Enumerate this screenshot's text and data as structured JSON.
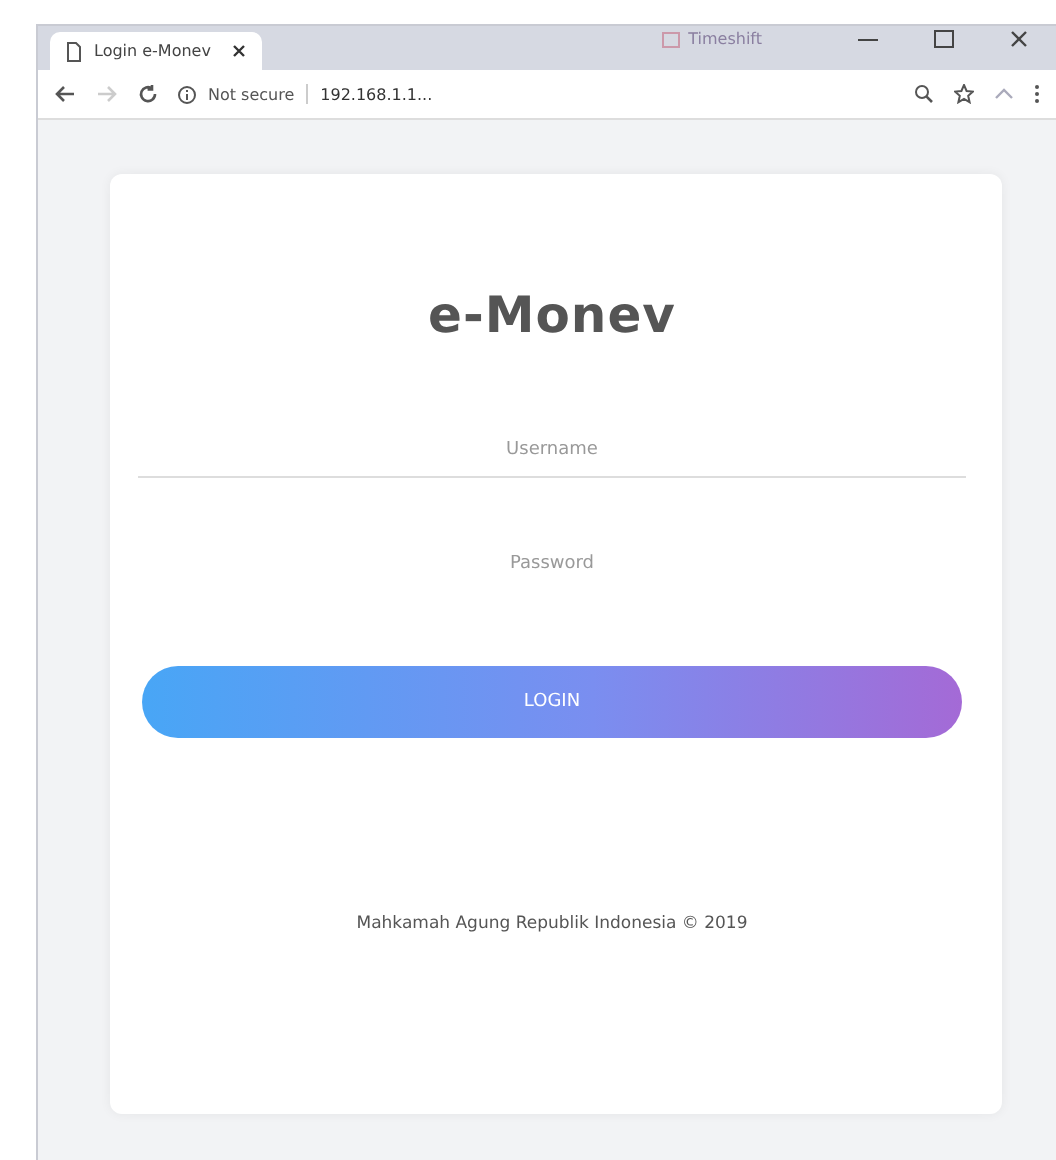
{
  "window": {
    "profile": "Timeshift"
  },
  "tab": {
    "title": "Login e-Monev",
    "selected": true
  },
  "address_bar": {
    "security": "Not secure",
    "url": "192.168.1.1..."
  },
  "login": {
    "title": "e-Monev",
    "username": {
      "placeholder": "Username"
    },
    "password": {
      "placeholder": "Password"
    },
    "button": "LOGIN",
    "footer": "Mahkamah Agung Republik Indonesia © 2019"
  }
}
